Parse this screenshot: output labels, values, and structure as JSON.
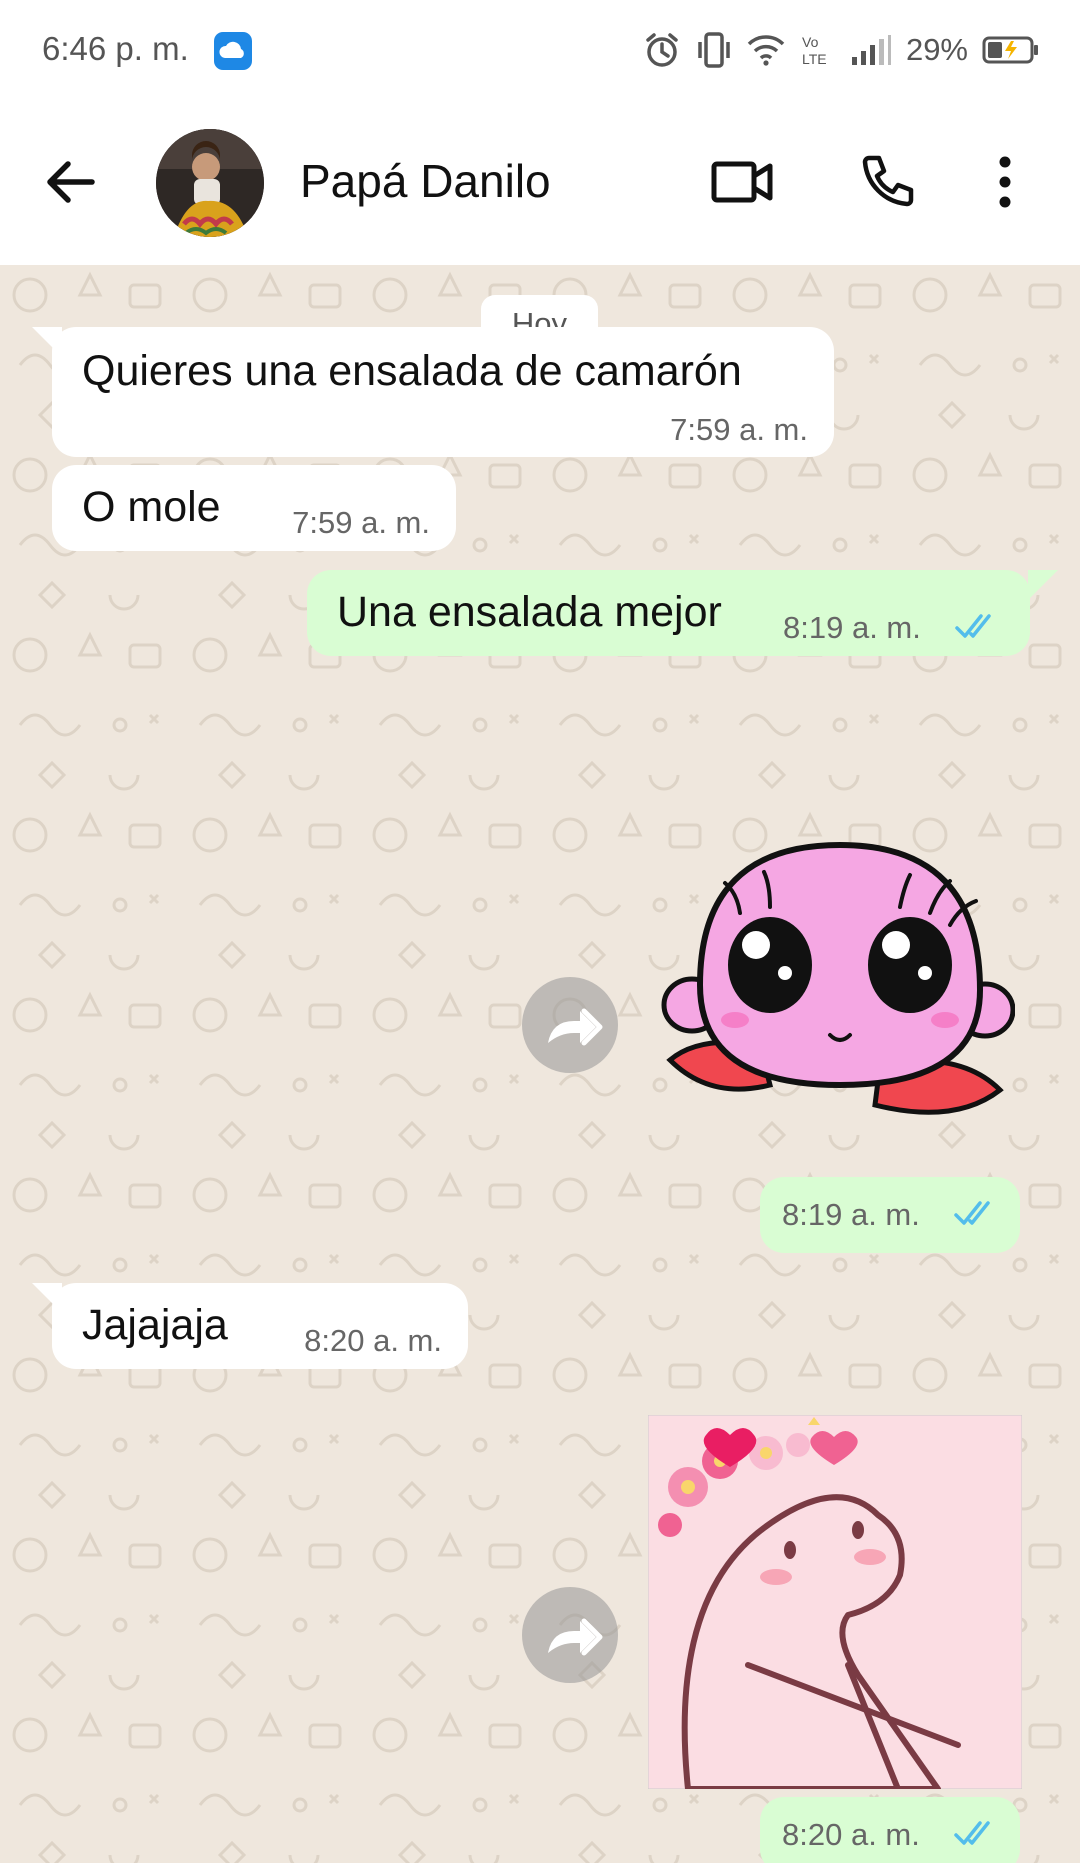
{
  "status_bar": {
    "time": "6:46 p. m.",
    "battery_percent": "29%",
    "volte": "Vo LTE"
  },
  "header": {
    "contact_name": "Papá Danilo"
  },
  "chat": {
    "day_label": "Hoy",
    "messages": [
      {
        "direction": "in",
        "text": "Quieres una ensalada de camarón",
        "time": "7:59 a. m."
      },
      {
        "direction": "in",
        "text": "O mole",
        "time": "7:59 a. m."
      },
      {
        "direction": "out",
        "text": "Una ensalada mejor",
        "time": "8:19 a. m.",
        "status": "read"
      },
      {
        "direction": "out",
        "type": "sticker",
        "sticker": "pink-kirby",
        "time": "8:19 a. m.",
        "status": "read"
      },
      {
        "direction": "in",
        "text": "Jajajaja",
        "time": "8:20 a. m."
      },
      {
        "direction": "out",
        "type": "sticker",
        "sticker": "flork-flower-crown",
        "time": "8:20 a. m.",
        "status": "read"
      }
    ]
  },
  "colors": {
    "incoming_bubble": "#ffffff",
    "outgoing_bubble": "#d9fdd3",
    "chat_background": "#efe7dd",
    "read_ticks": "#53bdeb"
  },
  "icons": [
    "back-arrow-icon",
    "video-call-icon",
    "phone-icon",
    "more-vert-icon",
    "forward-icon",
    "alarm-icon",
    "vibrate-icon",
    "wifi-icon",
    "signal-icon",
    "battery-icon",
    "cloud-icon"
  ]
}
